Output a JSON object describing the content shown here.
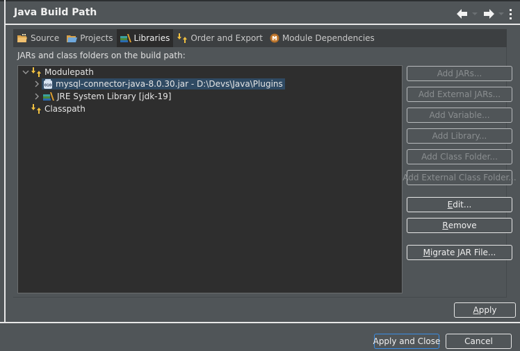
{
  "header": {
    "title": "Java Build Path",
    "nav": [
      {
        "icon": "back-arrow-icon"
      },
      {
        "icon": "forward-arrow-icon"
      },
      {
        "icon": "kebab-menu-icon"
      }
    ]
  },
  "tabs": [
    {
      "label": "Source",
      "icon": "source-folder-icon",
      "active": false
    },
    {
      "label": "Projects",
      "icon": "projects-folder-icon",
      "active": false
    },
    {
      "label": "Libraries",
      "icon": "libraries-books-icon",
      "active": true
    },
    {
      "label": "Order and Export",
      "icon": "order-export-arrows-icon",
      "active": false
    },
    {
      "label": "Module Dependencies",
      "icon": "module-m-icon",
      "active": false
    }
  ],
  "panel": {
    "label": "JARs and class folders on the build path:",
    "tree": [
      {
        "label": "Modulepath",
        "icon": "modulepath-icon",
        "expanded": true,
        "level": 0
      },
      {
        "label": "mysql-connector-java-8.0.30.jar - D:\\Devs\\Java\\Plugins",
        "icon": "jar-icon",
        "expanded": false,
        "level": 1,
        "selected": true
      },
      {
        "label": "JRE System Library [jdk-19]",
        "icon": "library-icon",
        "expanded": false,
        "level": 1
      },
      {
        "label": "Classpath",
        "icon": "classpath-icon",
        "level": 0
      }
    ]
  },
  "side_buttons": [
    {
      "label": "Add JARs...",
      "enabled": false
    },
    {
      "label": "Add External JARs...",
      "enabled": false
    },
    {
      "label": "Add Variable...",
      "enabled": false
    },
    {
      "label": "Add Library...",
      "enabled": false
    },
    {
      "label": "Add Class Folder...",
      "enabled": false
    },
    {
      "label": "Add External Class Folder...",
      "enabled": false
    },
    {
      "label": "Edit...",
      "enabled": true,
      "mnemonic": "E"
    },
    {
      "label": "Remove",
      "enabled": true,
      "mnemonic": "R"
    },
    {
      "label": "Migrate JAR File...",
      "enabled": true,
      "mnemonic": "M"
    }
  ],
  "apply": {
    "label": "Apply",
    "mnemonic": "A"
  },
  "footer": {
    "apply_close": "Apply and Close",
    "cancel": "Cancel"
  }
}
